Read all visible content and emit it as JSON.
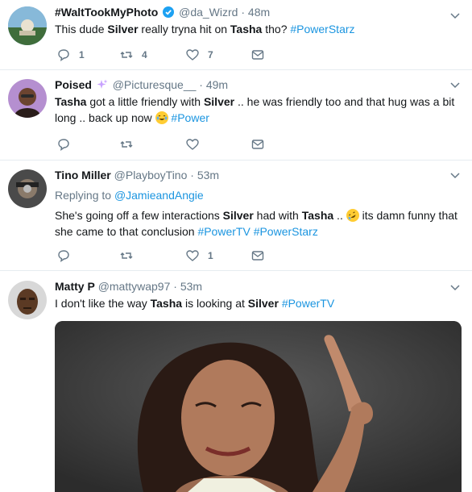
{
  "tweets": [
    {
      "name": "#WaltTookMyPhoto",
      "handle": "@da_Wizrd",
      "time": "48m",
      "text": [
        "This dude ",
        "Silver",
        " really tryna hit on ",
        "Tasha",
        " tho? ",
        "#PowerStarz"
      ],
      "reply_count": "1",
      "retweet_count": "4",
      "like_count": "7"
    },
    {
      "name": "Poised",
      "handle": "@Picturesque__",
      "time": "49m",
      "text": [
        "Tasha",
        " got a little friendly with ",
        "Silver",
        " .. he was friendly too and that hug was a bit long .. back up now ",
        "#Power"
      ],
      "reply_count": "",
      "retweet_count": "",
      "like_count": ""
    },
    {
      "name": "Tino Miller",
      "handle": "@PlayboyTino",
      "time": "53m",
      "replying_label": "Replying to",
      "replying_to": "@JamieandAngie",
      "text": [
        "She's going off a few interactions ",
        "Silver",
        " had with ",
        "Tasha",
        " .. ",
        " its damn funny that she came to that conclusion ",
        "#PowerTV",
        " ",
        "#PowerStarz"
      ],
      "reply_count": "",
      "retweet_count": "",
      "like_count": "1"
    },
    {
      "name": "Matty P",
      "handle": "@mattywap97",
      "time": "53m",
      "text": [
        "I don't like the way ",
        "Tasha",
        " is looking at ",
        "Silver",
        " ",
        "#PowerTV"
      ]
    }
  ],
  "separator": "·",
  "colors": {
    "accent": "#1b95e0",
    "muted": "#657786",
    "text": "#14171a",
    "border": "#e6ecf0"
  },
  "icons": [
    "verified-badge-icon",
    "sparkles-icon",
    "caret-down-icon",
    "reply-icon",
    "retweet-icon",
    "like-icon",
    "direct-message-icon",
    "tears-of-joy-emoji",
    "rofl-emoji"
  ]
}
